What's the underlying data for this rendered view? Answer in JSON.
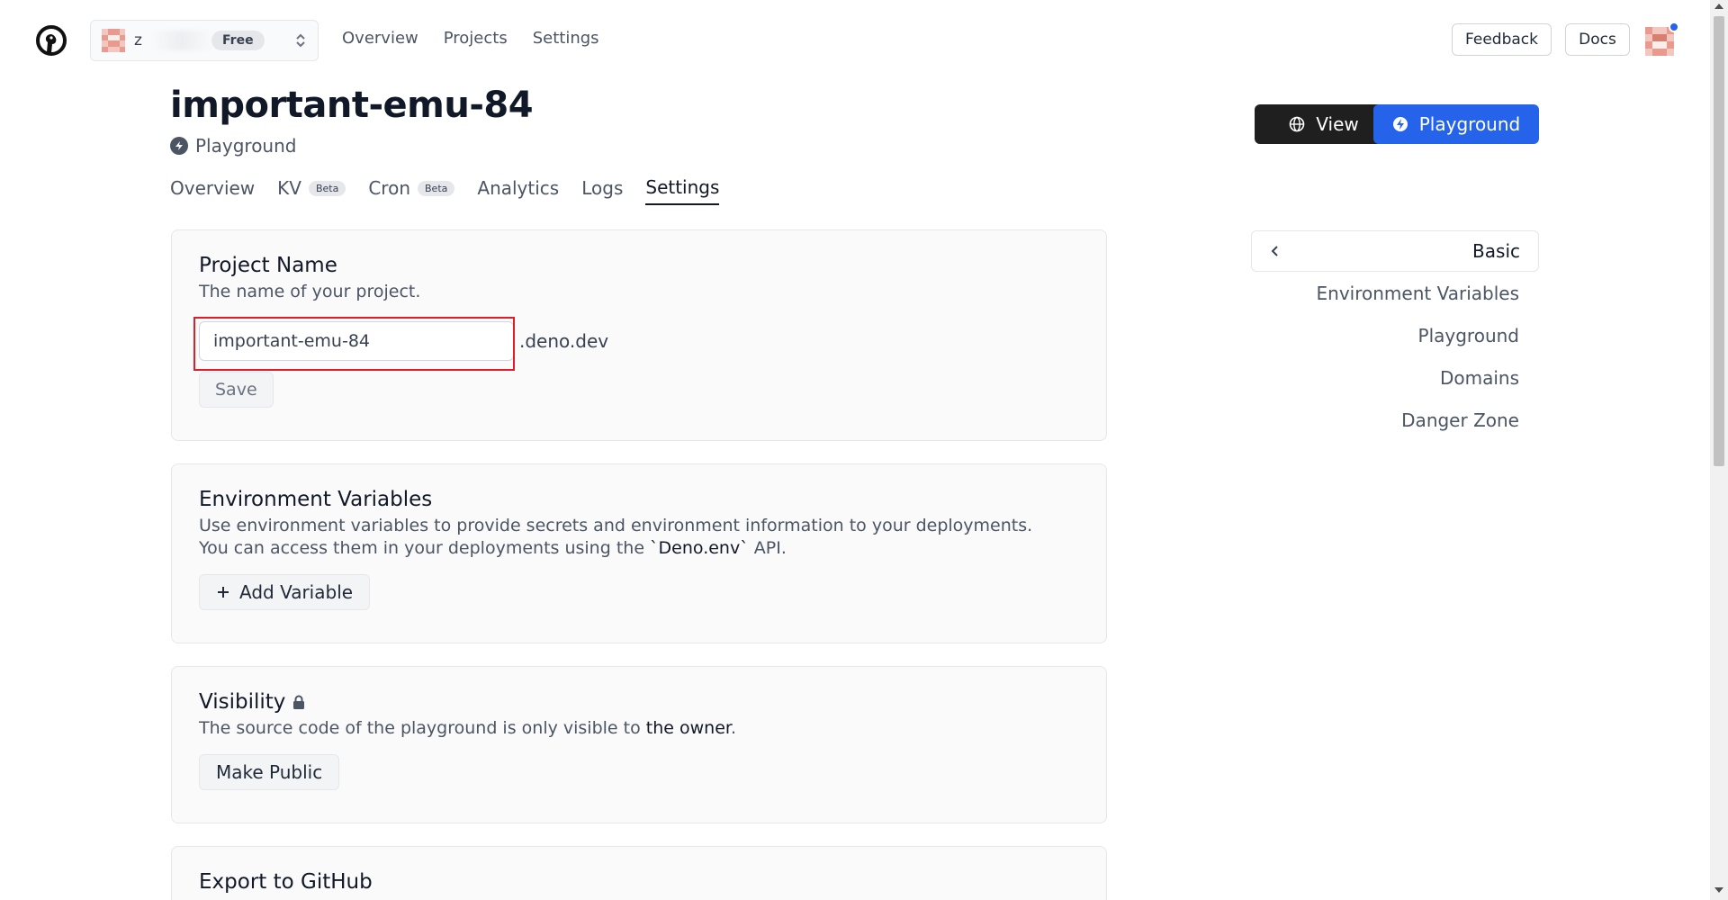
{
  "topnav": {
    "org_name": "z",
    "plan_badge": "Free",
    "links": [
      "Overview",
      "Projects",
      "Settings"
    ],
    "feedback_label": "Feedback",
    "docs_label": "Docs"
  },
  "project": {
    "title": "important-emu-84",
    "type_label": "Playground",
    "view_label": "View",
    "playground_label": "Playground"
  },
  "tabs": [
    {
      "label": "Overview",
      "badge": ""
    },
    {
      "label": "KV",
      "badge": "Beta"
    },
    {
      "label": "Cron",
      "badge": "Beta"
    },
    {
      "label": "Analytics",
      "badge": ""
    },
    {
      "label": "Logs",
      "badge": ""
    },
    {
      "label": "Settings",
      "badge": "",
      "active": true
    }
  ],
  "project_name_card": {
    "title": "Project Name",
    "description": "The name of your project.",
    "input_value": "important-emu-84",
    "suffix": ".deno.dev",
    "save_label": "Save"
  },
  "env_card": {
    "title": "Environment Variables",
    "line1": "Use environment variables to provide secrets and environment information to your deployments.",
    "line2_pre": "You can access them in your deployments using the ",
    "line2_code": "`Deno.env`",
    "line2_post": " API.",
    "add_label": "Add Variable"
  },
  "visibility_card": {
    "title": "Visibility",
    "desc_pre": "The source code of the playground is only visible to ",
    "desc_strong": "the owner",
    "desc_post": ".",
    "button_label": "Make Public"
  },
  "export_card": {
    "title": "Export to GitHub"
  },
  "side_menu": {
    "current": "Basic",
    "items": [
      "Environment Variables",
      "Playground",
      "Domains",
      "Danger Zone"
    ]
  },
  "colors": {
    "primary_blue": "#2563eb",
    "dark_button": "#1f1f1f",
    "highlight_red": "#e11d2a"
  }
}
